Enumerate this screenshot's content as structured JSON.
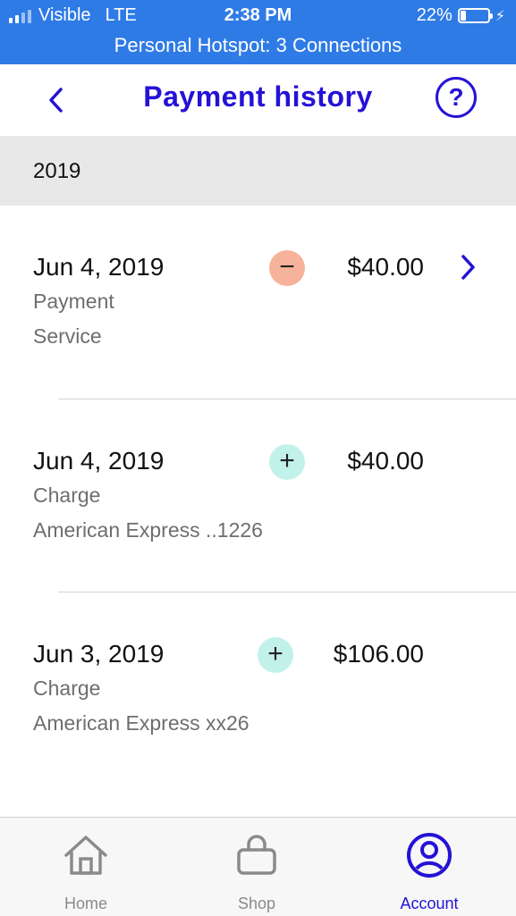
{
  "status_bar": {
    "carrier": "Visible",
    "network": "LTE",
    "time": "2:38 PM",
    "battery_percent": "22%",
    "battery_level": 0.22,
    "hotspot": "Personal Hotspot: 3 Connections"
  },
  "header": {
    "title": "Payment history",
    "back_icon": "chevron-left-icon",
    "help_icon": "?"
  },
  "section": {
    "year": "2019"
  },
  "transactions": [
    {
      "date": "Jun 4, 2019",
      "type": "Payment",
      "detail": "Service",
      "sign": "−",
      "sign_kind": "minus",
      "amount": "$40.00",
      "has_chevron": true
    },
    {
      "date": "Jun 4, 2019",
      "type": "Charge",
      "detail": "American Express ..1226",
      "sign": "+",
      "sign_kind": "plus",
      "amount": "$40.00",
      "has_chevron": false
    },
    {
      "date": "Jun 3, 2019",
      "type": "Charge",
      "detail": "American Express xx26",
      "sign": "+",
      "sign_kind": "plus",
      "amount": "$106.00",
      "has_chevron": false
    }
  ],
  "tabs": [
    {
      "label": "Home",
      "icon": "home-icon",
      "active": false
    },
    {
      "label": "Shop",
      "icon": "shopping-bag-icon",
      "active": false
    },
    {
      "label": "Account",
      "icon": "account-icon",
      "active": true
    }
  ],
  "colors": {
    "status_bar": "#2f7be6",
    "accent": "#2412d6",
    "minus_badge": "#f6b29a",
    "plus_badge": "#c2f1ea",
    "section_bg": "#e8e8e8"
  }
}
